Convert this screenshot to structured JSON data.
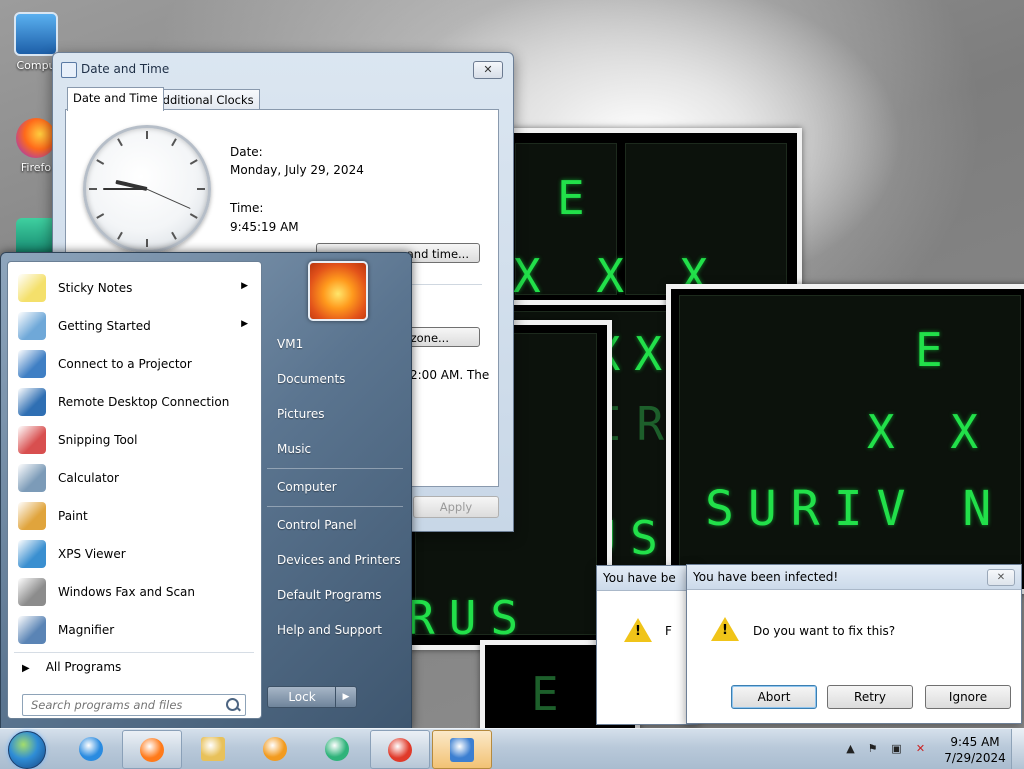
{
  "desktop": {
    "icons": [
      {
        "label": "Compu"
      },
      {
        "label": "Firefo"
      }
    ]
  },
  "virus": {
    "line_e": "E",
    "line_xxx": "X X X",
    "line_exxus": "EXXUS",
    "line_virus": "VIRUS",
    "line_xxus": "XXUS",
    "line_rus": "RUS",
    "line_suriv": "SURIV N E X X",
    "line_e_dim": "E",
    "text_color": "#22e04a"
  },
  "date_time_window": {
    "title": "Date and Time",
    "close_label": "✕",
    "tabs": [
      {
        "label": "Date and Time",
        "active": true
      },
      {
        "label": "Additional Clocks",
        "active": false
      }
    ],
    "date_label": "Date:",
    "date_value": "Monday, July 29, 2024",
    "time_label": "Time:",
    "time_value": "9:45:19 AM",
    "change_datetime_button": "and time...",
    "change_timezone_button": "zone...",
    "dst_text_fragment": "2:00 AM. The",
    "apply_button": "Apply"
  },
  "dialogs": {
    "back": {
      "title": "You have be",
      "message_fragment": "F"
    },
    "front": {
      "title": "You have been infected!",
      "close_label": "✕",
      "message": "Do you want to fix this?",
      "buttons": [
        "Abort",
        "Retry",
        "Ignore"
      ]
    }
  },
  "start_menu": {
    "programs": [
      {
        "label": "Sticky Notes",
        "has_submenu": true,
        "icon": "sticky-notes-icon",
        "color": "#f4e06b"
      },
      {
        "label": "Getting Started",
        "has_submenu": true,
        "icon": "getting-started-icon",
        "color": "#6fa8d8"
      },
      {
        "label": "Connect to a Projector",
        "has_submenu": false,
        "icon": "projector-icon",
        "color": "#3f7fc4"
      },
      {
        "label": "Remote Desktop Connection",
        "has_submenu": false,
        "icon": "remote-desktop-icon",
        "color": "#2f6fb3"
      },
      {
        "label": "Snipping Tool",
        "has_submenu": false,
        "icon": "scissors-icon",
        "color": "#d84f4f"
      },
      {
        "label": "Calculator",
        "has_submenu": false,
        "icon": "calculator-icon",
        "color": "#7c9bb8"
      },
      {
        "label": "Paint",
        "has_submenu": false,
        "icon": "paint-palette-icon",
        "color": "#e0a43c"
      },
      {
        "label": "XPS Viewer",
        "has_submenu": false,
        "icon": "xps-viewer-icon",
        "color": "#3a8fd0"
      },
      {
        "label": "Windows Fax and Scan",
        "has_submenu": false,
        "icon": "fax-icon",
        "color": "#8c8c8c"
      },
      {
        "label": "Magnifier",
        "has_submenu": false,
        "icon": "magnifier-icon",
        "color": "#5a84b5"
      }
    ],
    "all_programs": "All Programs",
    "search_placeholder": "Search programs and files",
    "right_items": {
      "user": "VM1",
      "documents": "Documents",
      "pictures": "Pictures",
      "music": "Music",
      "computer": "Computer",
      "control_panel": "Control Panel",
      "devices": "Devices and Printers",
      "default_programs": "Default Programs",
      "help": "Help and Support"
    },
    "lock_label": "Lock",
    "lock_arrow": "▶"
  },
  "taskbar": {
    "pinned": [
      {
        "name": "internet-explorer-icon",
        "color": "#2a8be0"
      },
      {
        "name": "firefox-icon",
        "color": "#ff7a1a"
      },
      {
        "name": "file-explorer-icon",
        "color": "#e8c15a"
      },
      {
        "name": "media-player-icon",
        "color": "#f29b20"
      },
      {
        "name": "app-green-icon",
        "color": "#2fb37a"
      },
      {
        "name": "app-red-face-icon",
        "color": "#e03a2a"
      },
      {
        "name": "date-time-app-icon",
        "color": "#3c7fd1"
      }
    ],
    "clock_time": "9:45 AM",
    "clock_date": "7/29/2024",
    "tray_expand": "▲"
  }
}
